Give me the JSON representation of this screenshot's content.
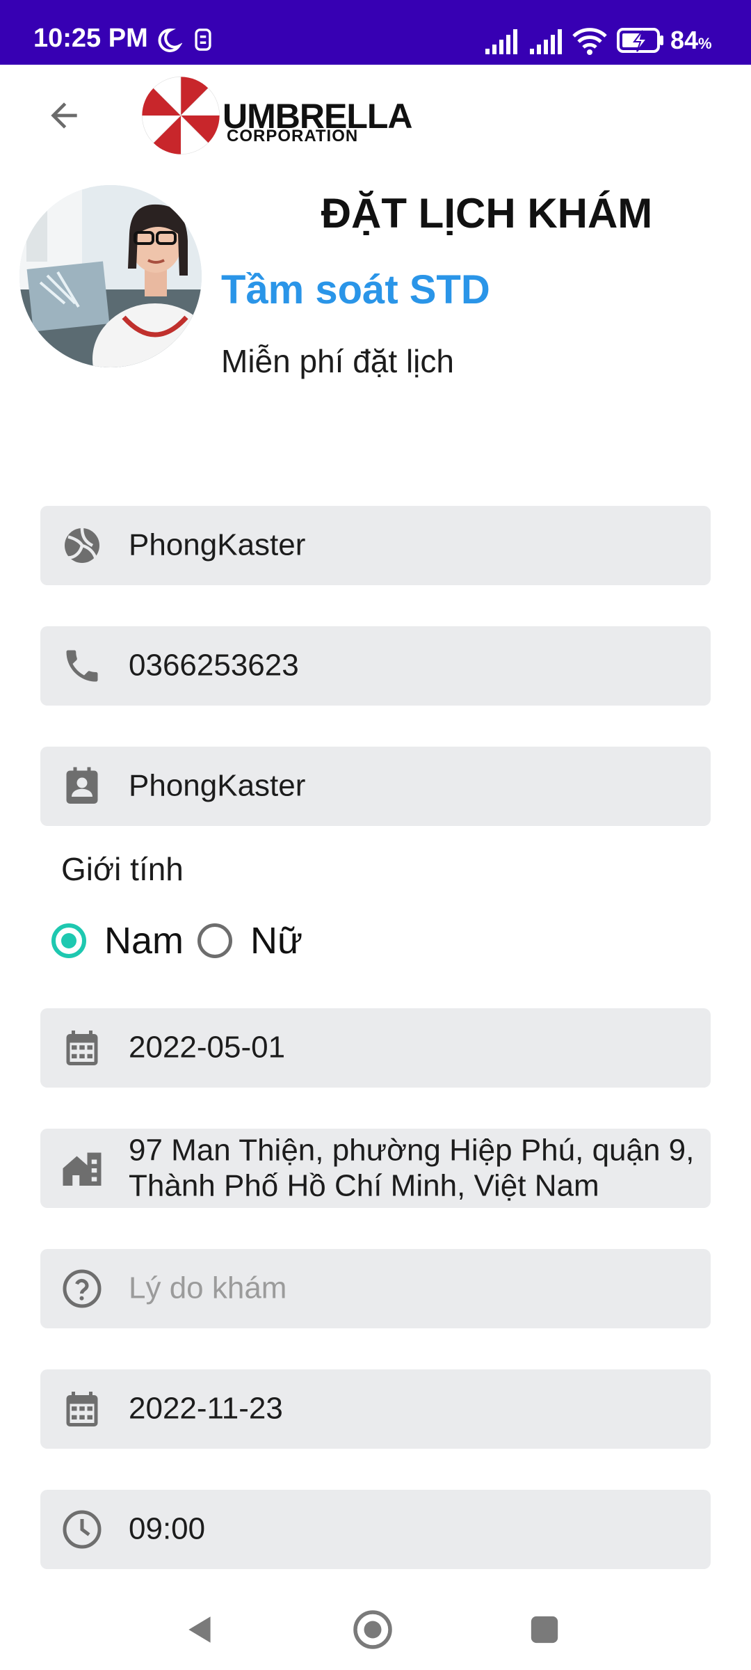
{
  "status_bar": {
    "time": "10:25 PM",
    "battery_percent": "84",
    "battery_unit": "%",
    "icons": [
      "moon-icon",
      "app-tile-icon",
      "signal-icon",
      "signal-icon",
      "wifi-icon",
      "battery-charging-icon"
    ]
  },
  "app_bar": {
    "back_icon": "arrow-back-icon",
    "logo_word": "UMBRELLA",
    "logo_sub": "CORPORATION"
  },
  "header": {
    "title": "ĐẶT LỊCH KHÁM",
    "service_name": "Tầm soát STD",
    "service_note": "Miễn phí đặt lịch"
  },
  "form": {
    "name": {
      "icon": "volleyball-icon",
      "value": "PhongKaster"
    },
    "phone": {
      "icon": "phone-icon",
      "value": "0366253623"
    },
    "contact_name": {
      "icon": "contact-card-icon",
      "value": "PhongKaster"
    },
    "gender": {
      "label": "Giới tính",
      "options": [
        {
          "label": "Nam",
          "selected": true
        },
        {
          "label": "Nữ",
          "selected": false
        }
      ]
    },
    "birth_date": {
      "icon": "calendar-icon",
      "value": "2022-05-01"
    },
    "address": {
      "icon": "home-building-icon",
      "value": "97 Man Thiện, phường Hiệp Phú, quận 9, Thành Phố Hồ Chí Minh, Việt Nam"
    },
    "reason": {
      "icon": "help-circle-icon",
      "placeholder": "Lý do khám"
    },
    "appointment_date": {
      "icon": "calendar-icon",
      "value": "2022-11-23"
    },
    "appointment_time": {
      "icon": "clock-icon",
      "value": "09:00"
    }
  },
  "colors": {
    "status_bar": "#3700b3",
    "accent_blue": "#2a95e8",
    "radio_selected": "#1ec8b0",
    "field_bg": "#eaebed",
    "icon_gray": "#6e6e6e"
  },
  "nav_bar": {
    "icons": [
      "nav-back-icon",
      "nav-home-icon",
      "nav-recents-icon"
    ]
  }
}
